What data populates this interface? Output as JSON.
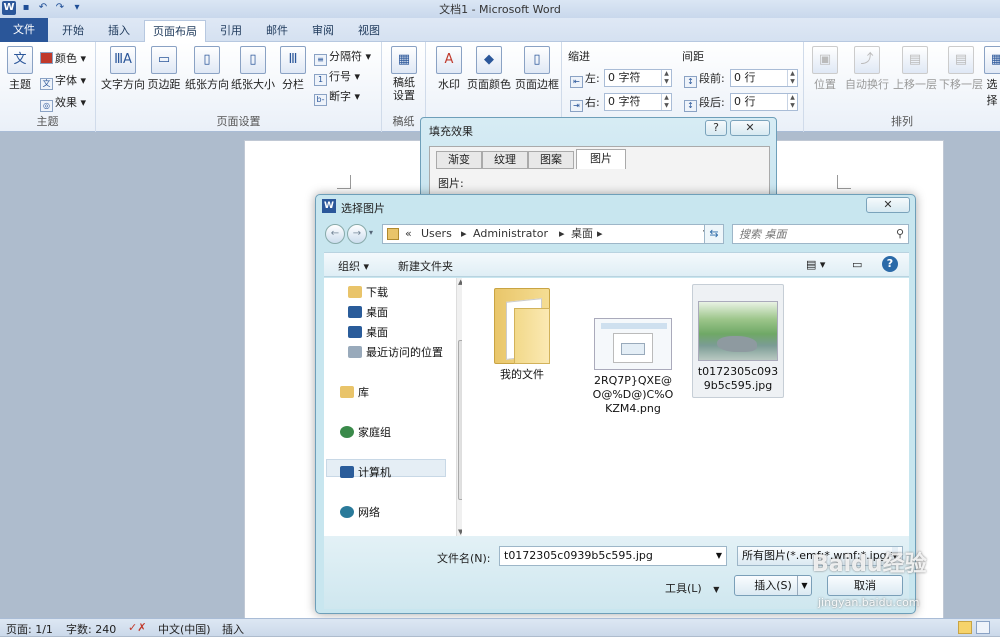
{
  "window": {
    "title": "文档1 - Microsoft Word"
  },
  "quick_access": {
    "logo": "W",
    "undo": "↶",
    "redo": "↷"
  },
  "tabs": [
    "文件",
    "开始",
    "插入",
    "页面布局",
    "引用",
    "邮件",
    "审阅",
    "视图"
  ],
  "ribbon": {
    "theme_group": {
      "label": "主题",
      "theme_btn": "主题",
      "colors": "颜色",
      "fonts": "字体",
      "effects": "效果"
    },
    "page_setup": {
      "label": "页面设置",
      "text_dir": "文字方向",
      "margins": "页边距",
      "orientation": "纸张方向",
      "size": "纸张大小",
      "columns": "分栏",
      "breaks": "分隔符",
      "line_numbers": "行号",
      "hyphenation": "断字"
    },
    "paper_group": {
      "label": "稿纸",
      "btn_line1": "稿纸",
      "btn_line2": "设置"
    },
    "background": {
      "watermark": "水印",
      "page_color": "页面颜色",
      "page_border": "页面边框"
    },
    "paragraph": {
      "indent": "缩进",
      "left": "左:",
      "right": "右:",
      "left_val": "0 字符",
      "right_val": "0 字符",
      "spacing": "间距",
      "before": "段前:",
      "after": "段后:",
      "before_val": "0 行",
      "after_val": "0 行"
    },
    "arrange": {
      "label": "排列",
      "position": "位置",
      "wrap": "自动换行",
      "forward": "上移一层",
      "backward": "下移一层",
      "select": "选择"
    }
  },
  "fill_dialog": {
    "title": "填充效果",
    "help": "?",
    "close": "✕",
    "tabs": [
      "渐变",
      "纹理",
      "图案",
      "图片"
    ],
    "picture_label": "图片:"
  },
  "picker": {
    "title": "选择图片",
    "logo": "W",
    "close": "✕",
    "path": [
      "«",
      "Users",
      "Administrator",
      "桌面"
    ],
    "search_placeholder": "搜索 桌面",
    "organize": "组织 ▾",
    "new_folder": "新建文件夹",
    "nav": [
      "下载",
      "桌面",
      "桌面",
      "最近访问的位置",
      "库",
      "家庭组",
      "计算机",
      "网络"
    ],
    "files": [
      {
        "name": "我的文件"
      },
      {
        "name": "2RQ7P}QXE@O@%D@)C%OKZM4.png"
      },
      {
        "name": "t0172305c0939b5c595.jpg"
      }
    ],
    "filename_label": "文件名(N):",
    "filename_value": "t0172305c0939b5c595.jpg",
    "filetype": "所有图片(*.emf;*.wmf;*.jpg;*",
    "tools": "工具(L)",
    "insert": "插入(S)",
    "cancel": "取消"
  },
  "status": {
    "page": "页面: 1/1",
    "words": "字数: 240",
    "lang": "中文(中国)",
    "mode": "插入"
  },
  "watermark": {
    "logo": "Baidu经验",
    "url": "jingyan.baidu.com"
  },
  "colors": {
    "accent": "#2b579a",
    "dialog": "#c8e6ef"
  }
}
